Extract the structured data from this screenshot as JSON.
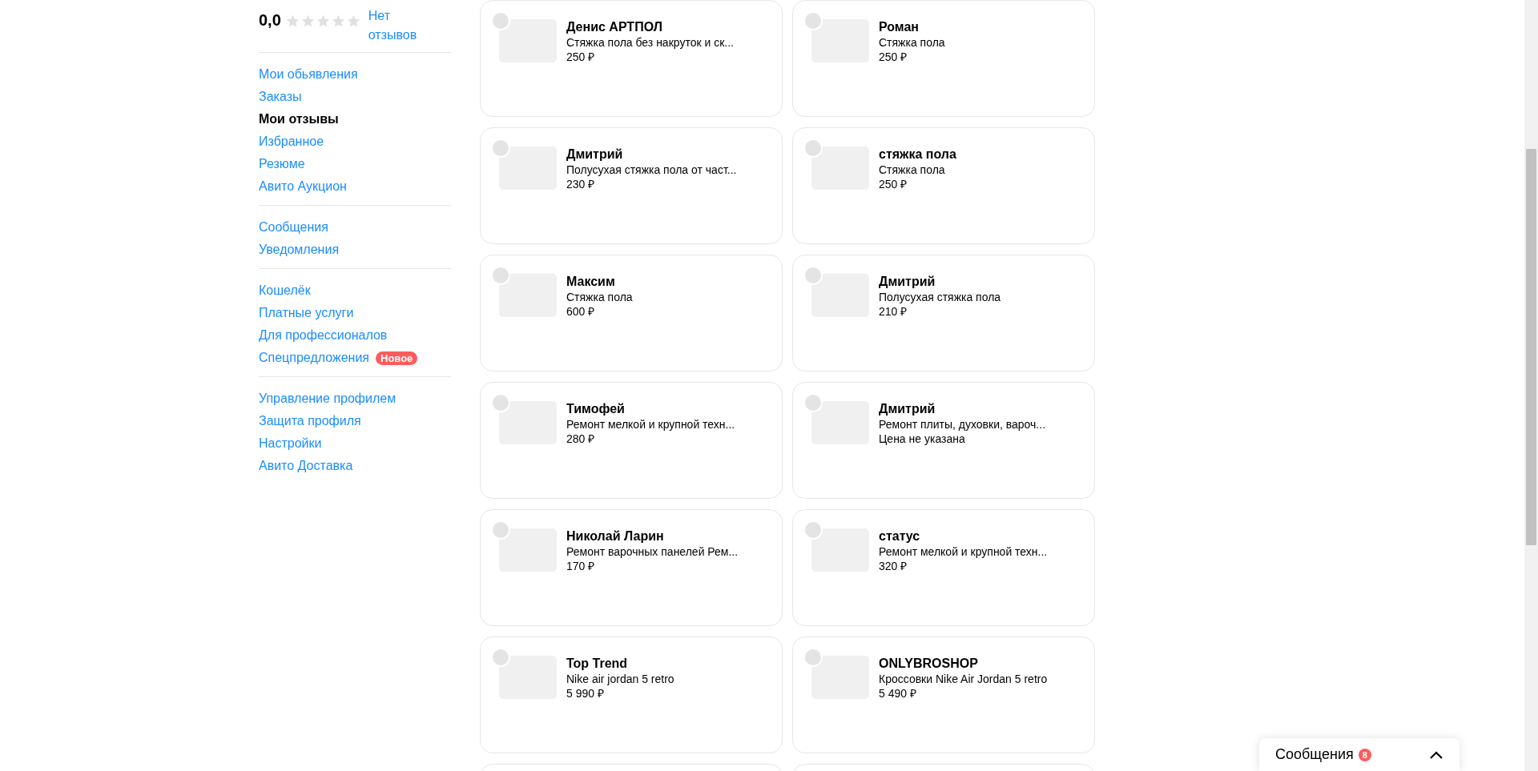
{
  "rating": {
    "score": "0,0",
    "stars": 0,
    "reviews_link": "Нет отзывов"
  },
  "sidebar": {
    "groups": [
      {
        "items": [
          {
            "label": "Мои обьявления",
            "selected": false
          },
          {
            "label": "Заказы",
            "selected": false
          },
          {
            "label": "Мои отзывы",
            "selected": true
          },
          {
            "label": "Избранное",
            "selected": false
          },
          {
            "label": "Резюме",
            "selected": false
          },
          {
            "label": "Авито Аукцион",
            "selected": false
          }
        ]
      },
      {
        "items": [
          {
            "label": "Сообщения",
            "selected": false
          },
          {
            "label": "Уведомления",
            "selected": false
          }
        ]
      },
      {
        "items": [
          {
            "label": "Кошелёк",
            "selected": false
          },
          {
            "label": "Платные услуги",
            "selected": false
          },
          {
            "label": "Для профессионалов",
            "selected": false
          },
          {
            "label": "Спецпредложения",
            "selected": false,
            "badge": "Новое"
          }
        ]
      },
      {
        "items": [
          {
            "label": "Управление профилем",
            "selected": false
          },
          {
            "label": "Защита профиля",
            "selected": false
          },
          {
            "label": "Настройки",
            "selected": false
          },
          {
            "label": "Авито Доставка",
            "selected": false
          }
        ]
      }
    ]
  },
  "reviews": [
    {
      "name": "Денис АРТПОЛ",
      "title": "Стяжка пола без накруток и ск...",
      "price": "250 ₽"
    },
    {
      "name": "Роман",
      "title": "Стяжка пола",
      "price": "250 ₽"
    },
    {
      "name": "Дмитрий",
      "title": "Полусухая стяжка пола от част...",
      "price": "230 ₽"
    },
    {
      "name": "стяжка пола",
      "title": "Стяжка пола",
      "price": "250 ₽"
    },
    {
      "name": "Максим",
      "title": "Стяжка пола",
      "price": "600 ₽"
    },
    {
      "name": "Дмитрий",
      "title": "Полусухая стяжка пола",
      "price": "210 ₽"
    },
    {
      "name": "Тимофей",
      "title": "Ремонт мелкой и крупной техн...",
      "price": "280 ₽"
    },
    {
      "name": "Дмитрий",
      "title": "Ремонт плиты, духовки, вароч...",
      "price": "Цена не указана"
    },
    {
      "name": "Николай Ларин",
      "title": "Ремонт варочных панелей Рем...",
      "price": "170 ₽"
    },
    {
      "name": "статус",
      "title": "Ремонт мелкой и крупной техн...",
      "price": "320 ₽"
    },
    {
      "name": "Top Trend",
      "title": "Nike air jordan 5 retro",
      "price": "5 990 ₽"
    },
    {
      "name": "ONLYBROSHOP",
      "title": "Кроссовки Nike Air Jordan 5 retro",
      "price": "5 490 ₽"
    }
  ],
  "messages_widget": {
    "title": "Сообщения",
    "count": "8"
  }
}
